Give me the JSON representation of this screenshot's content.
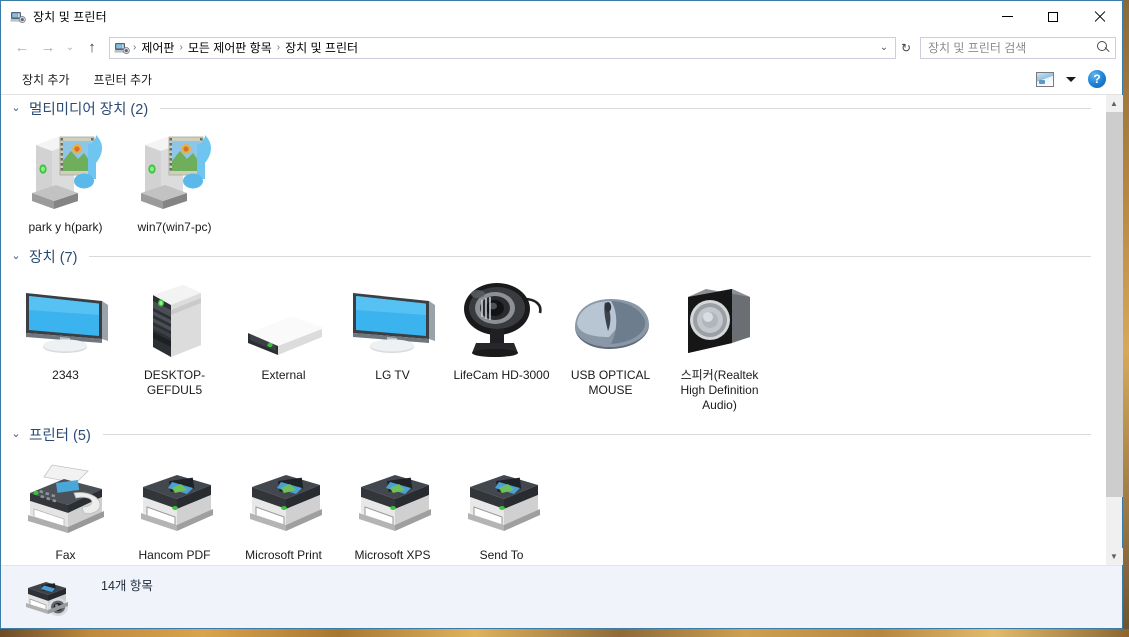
{
  "window": {
    "title": "장치 및 프린터",
    "icon": "devices-printers-icon",
    "controls": {
      "minimize": "최소화",
      "maximize": "최대화",
      "close": "닫기"
    }
  },
  "navbar": {
    "back": "뒤로",
    "forward": "앞으로",
    "recent": "최근 위치",
    "up": "위로",
    "address_icon": "devices-printers-icon",
    "breadcrumbs": [
      "제어판",
      "모든 제어판 항목",
      "장치 및 프린터"
    ],
    "separator": "›",
    "dropdown": "⌄",
    "refresh": "↻"
  },
  "search": {
    "placeholder": "장치 및 프린터 검색",
    "value": "",
    "icon": "search-icon"
  },
  "toolbar": {
    "add_device": "장치 추가",
    "add_printer": "프린터 추가",
    "view_icon": "preview-pane-icon",
    "view_caret": "▾",
    "help": "?"
  },
  "sections": [
    {
      "id": "multimedia",
      "chevron": "⌄",
      "title": "멀티미디어 장치 (2)",
      "items": [
        {
          "label": "park y h(park)",
          "icon": "media-pc-icon"
        },
        {
          "label": "win7(win7-pc)",
          "icon": "media-pc-icon"
        }
      ]
    },
    {
      "id": "devices",
      "chevron": "⌄",
      "title": "장치 (7)",
      "items": [
        {
          "label": "2343",
          "icon": "monitor-icon"
        },
        {
          "label": "DESKTOP-GEFDUL5",
          "icon": "desktop-tower-icon"
        },
        {
          "label": "External",
          "icon": "external-drive-icon"
        },
        {
          "label": "LG TV",
          "icon": "monitor-icon"
        },
        {
          "label": "LifeCam HD-3000",
          "icon": "webcam-icon"
        },
        {
          "label": "USB OPTICAL MOUSE",
          "icon": "mouse-icon"
        },
        {
          "label": "스피커(Realtek High Definition Audio)",
          "icon": "speaker-icon"
        }
      ]
    },
    {
      "id": "printers",
      "chevron": "⌄",
      "title": "프린터 (5)",
      "items": [
        {
          "label": "Fax",
          "icon": "fax-icon"
        },
        {
          "label": "Hancom PDF",
          "icon": "printer-icon"
        },
        {
          "label": "Microsoft Print",
          "icon": "printer-icon"
        },
        {
          "label": "Microsoft XPS",
          "icon": "printer-icon"
        },
        {
          "label": "Send To",
          "icon": "printer-icon"
        }
      ]
    }
  ],
  "statusbar": {
    "item_count": "14개 항목",
    "preview_icon": "printer-camera-icon"
  },
  "colors": {
    "section_title": "#2b4b73",
    "window_border": "#3a7ca8",
    "accent_blue": "#1a7fd4",
    "status_bg": "#f0f4fa",
    "scrollbar_thumb": "#cdcdcd"
  }
}
